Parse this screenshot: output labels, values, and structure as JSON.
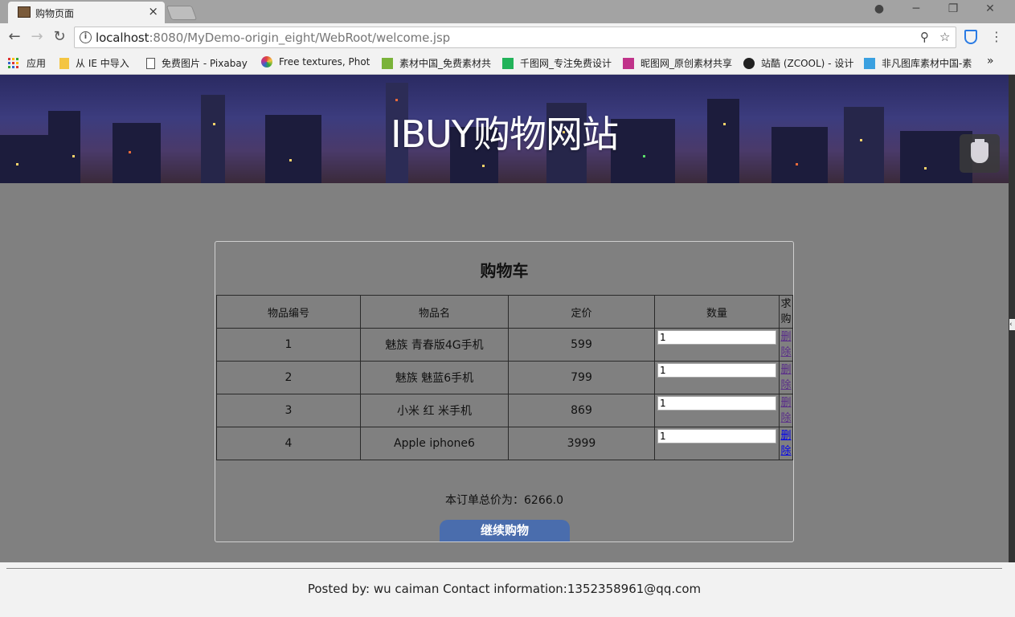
{
  "browser": {
    "tab_title": "购物页面",
    "tab_close": "×",
    "url_host": "localhost",
    "url_path": ":8080/MyDemo-origin_eight/WebRoot/welcome.jsp",
    "bookmarks": [
      {
        "label": "应用",
        "color": "#d33"
      },
      {
        "label": "从 IE 中导入",
        "color": "#f4c542"
      },
      {
        "label": "免费图片 - Pixabay",
        "color": "#ffffff"
      },
      {
        "label": "Free textures, Phot",
        "color": "#e0473a"
      },
      {
        "label": "素材中国_免费素材共",
        "color": "#7ab33a"
      },
      {
        "label": "千图网_专注免费设计",
        "color": "#22b35a"
      },
      {
        "label": "昵图网_原创素材共享",
        "color": "#c0338a"
      },
      {
        "label": "站酷 (ZCOOL) - 设计",
        "color": "#222222"
      },
      {
        "label": "非凡图库素材中国-素",
        "color": "#3aa0e0"
      }
    ],
    "bookmarks_more": "»"
  },
  "banner": {
    "title": "IBUY购物网站"
  },
  "cart": {
    "title": "购物车",
    "headers": {
      "id": "物品编号",
      "name": "物品名",
      "price": "定价",
      "qty": "数量",
      "want": "求购"
    },
    "rows": [
      {
        "id": "1",
        "name": "魅族 青春版4G手机",
        "price": "599",
        "qty": "1",
        "delete": "删除"
      },
      {
        "id": "2",
        "name": "魅族 魅蓝6手机",
        "price": "799",
        "qty": "1",
        "delete": "删除"
      },
      {
        "id": "3",
        "name": "小米 红 米手机",
        "price": "869",
        "qty": "1",
        "delete": "删除"
      },
      {
        "id": "4",
        "name": "Apple iphone6",
        "price": "3999",
        "qty": "1",
        "delete": "删除"
      }
    ],
    "total_label": "本订单总价为：",
    "total_value": "6266.0",
    "continue_label": "继续购物"
  },
  "footer": {
    "text": "Posted by: wu caiman Contact information:1352358961@qq.com"
  },
  "colors": {
    "page_bg": "#808080",
    "button": "#4a6dad",
    "visited_link": "#5a2d8a",
    "link": "#0000ee"
  }
}
